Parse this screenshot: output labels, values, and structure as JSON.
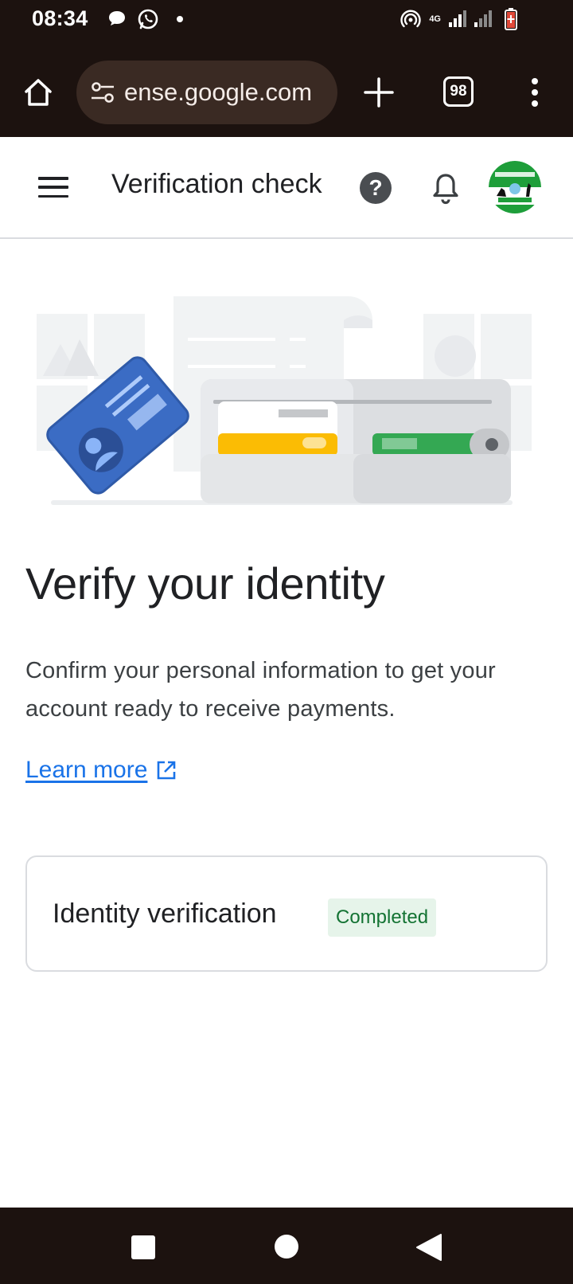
{
  "status_bar": {
    "time": "08:34",
    "network_label": "4G",
    "icons": [
      "chat-bubble-icon",
      "whatsapp-icon",
      "notification-dot",
      "hotspot-icon",
      "signal-icon",
      "battery-icon"
    ]
  },
  "browser": {
    "url": "ense.google.com",
    "tab_count": "98",
    "icons": [
      "home-icon",
      "site-settings-icon",
      "plus-icon",
      "tabs-icon",
      "more-vert-icon"
    ]
  },
  "header": {
    "title": "Verification check",
    "help": "?",
    "icons": [
      "menu-icon",
      "help-icon",
      "bell-icon",
      "avatar"
    ]
  },
  "main": {
    "heading": "Verify your identity",
    "description": "Confirm your personal information to get your account ready to receive payments.",
    "learn_more": "Learn more"
  },
  "card": {
    "label": "Identity verification",
    "status": "Completed"
  },
  "colors": {
    "system_bar": "#1c120f",
    "url_pill": "#3a2a23",
    "link": "#1a73e8",
    "badge_bg": "#e6f4ea",
    "badge_text": "#137333"
  },
  "nav": {
    "icons": [
      "recents-icon",
      "home-icon",
      "back-icon"
    ]
  }
}
